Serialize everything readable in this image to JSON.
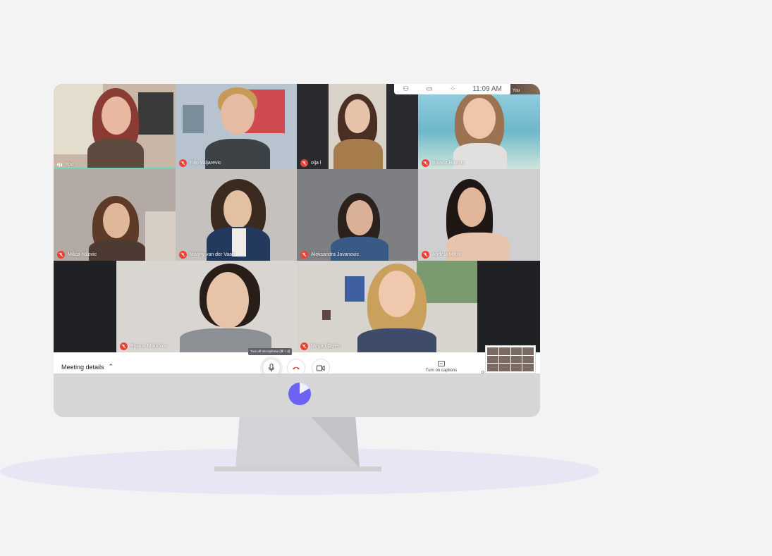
{
  "meeting": {
    "details_label": "Meeting details",
    "time": "11:09 AM",
    "tooltip": "Turn off microphone (⌘ + d)",
    "captions_label": "Turn on captions",
    "present_label_cut": "P",
    "self_thumb_label": "You"
  },
  "participants": [
    {
      "name": "You"
    },
    {
      "name": "Filip Valjarevic"
    },
    {
      "name": "olja l"
    },
    {
      "name": "Bojana Bozicic"
    },
    {
      "name": "Milica Milovic"
    },
    {
      "name": "Marley van der Vaart"
    },
    {
      "name": "Aleksandra Jovanovic"
    },
    {
      "name": "Anđela Milov"
    },
    {
      "name": "Bojana Marinkov"
    },
    {
      "name": "Megan Dalen"
    }
  ],
  "icons": {
    "chevron": "chevron-up-icon",
    "mic": "microphone-icon",
    "hangup": "phone-hangup-icon",
    "camera": "camera-icon",
    "captions": "captions-icon",
    "muted": "mic-off-icon",
    "logo": "brand-logo"
  },
  "colors": {
    "mute_red": "#ea4335",
    "hangup_red": "#ea4335",
    "active_speaker": "#6fd3c4",
    "logo_purple": "#6c63f5",
    "floor": "#e7e6f4",
    "bezel": "#d6d6d9"
  }
}
